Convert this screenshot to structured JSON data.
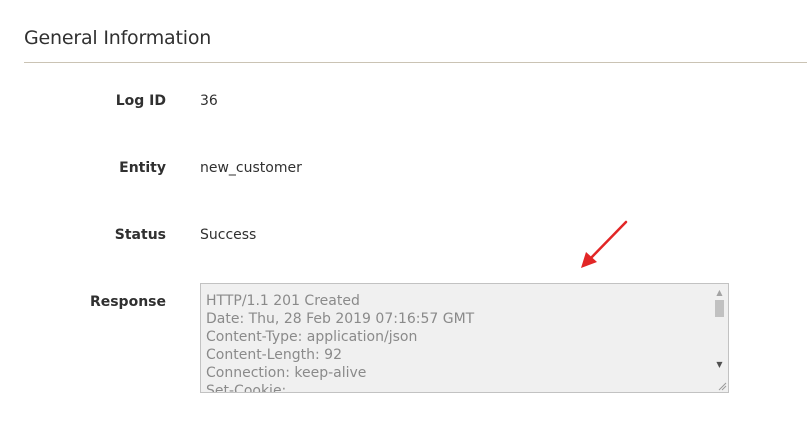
{
  "section": {
    "title": "General Information"
  },
  "fields": {
    "log_id": {
      "label": "Log ID",
      "value": "36"
    },
    "entity": {
      "label": "Entity",
      "value": "new_customer"
    },
    "status": {
      "label": "Status",
      "value": "Success"
    },
    "response": {
      "label": "Response",
      "value": "HTTP/1.1 201 Created\nDate: Thu, 28 Feb 2019 07:16:57 GMT\nContent-Type: application/json\nContent-Length: 92\nConnection: keep-alive\nSet-Cookie:"
    }
  },
  "icons": {
    "scroll_up": "scroll-up-arrow",
    "scroll_down": "scroll-down-arrow",
    "resize": "resize-grip",
    "annotation": "red-arrow"
  },
  "colors": {
    "annotation_arrow": "#e22626",
    "divider": "#cac3b4",
    "textarea_background": "#f0f0f0"
  }
}
